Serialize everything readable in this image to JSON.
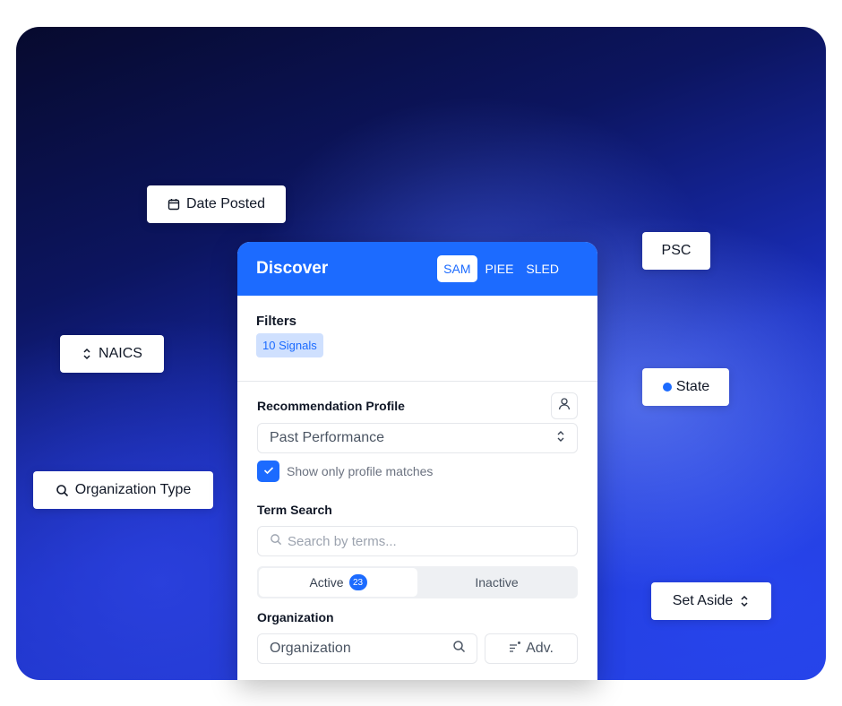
{
  "chips": {
    "date_posted": "Date Posted",
    "naics": "NAICS",
    "organization_type": "Organization Type",
    "psc": "PSC",
    "state": "State",
    "set_aside": "Set Aside"
  },
  "panel": {
    "title": "Discover",
    "tabs": [
      {
        "label": "SAM",
        "active": true
      },
      {
        "label": "PIEE",
        "active": false
      },
      {
        "label": "SLED",
        "active": false
      }
    ],
    "filters": {
      "heading": "Filters",
      "signals": "10 Signals"
    },
    "recommendation_profile": {
      "label": "Recommendation Profile",
      "selected": "Past Performance",
      "checkbox_label": "Show only profile matches",
      "checked": true
    },
    "term_search": {
      "label": "Term Search",
      "placeholder": "Search by terms..."
    },
    "status_toggle": {
      "active_label": "Active",
      "active_count": "23",
      "inactive_label": "Inactive"
    },
    "organization": {
      "label": "Organization",
      "placeholder": "Organization",
      "adv_label": "Adv."
    }
  },
  "colors": {
    "accent": "#1c6bff",
    "badge_bg": "#cfe0fe"
  },
  "icons": [
    "calendar-icon",
    "sort-chevrons-icon",
    "search-icon",
    "radio-dot-icon",
    "user-icon",
    "check-icon",
    "filter-lines-icon"
  ]
}
